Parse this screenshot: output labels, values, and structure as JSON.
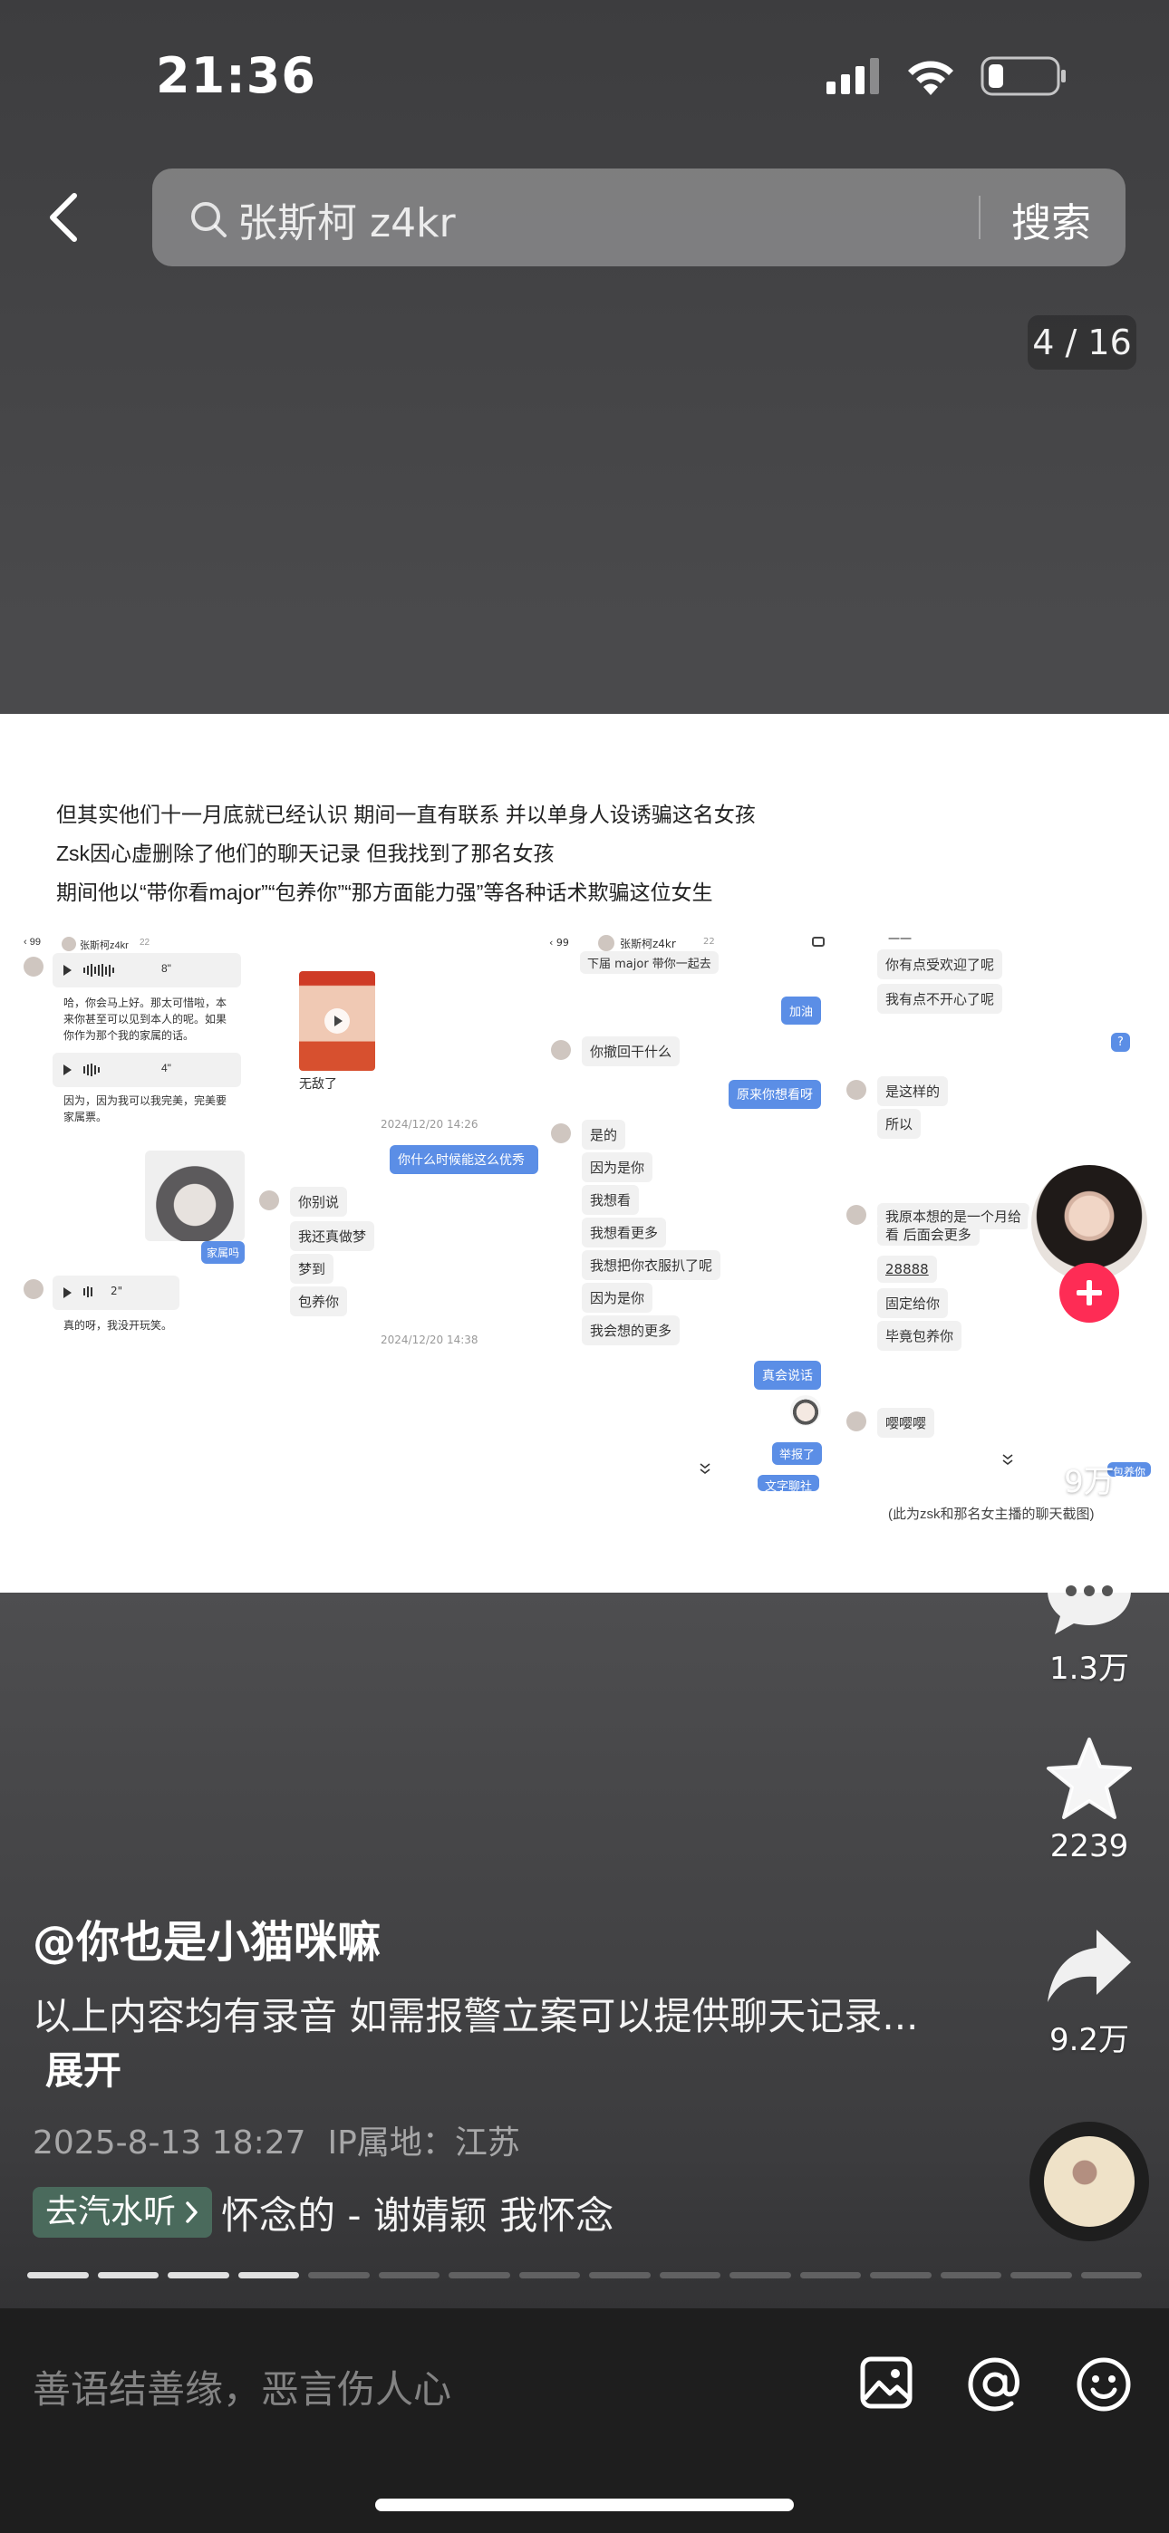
{
  "status_bar": {
    "time": "21:36"
  },
  "search": {
    "query": "张斯柯 z4kr",
    "button_label": "搜索"
  },
  "page_counter": "4 / 16",
  "post_image": {
    "caption_lines": [
      "但其实他们十一月底就已经认识 期间一直有联系 并以单身人设诱骗这名女孩",
      "Zsk因心虚删除了他们的聊天记录 但我找到了那名女孩",
      "期间他以“带你看major”“包养你”“那方面能力强”等各种话术欺骗这位女生"
    ],
    "left_chat": {
      "header_count": "99",
      "header_name": "张斯柯z4kr",
      "header_badge": "22",
      "voice1_duration": "8\"",
      "voice1_text": [
        "哈，你会马上好。那太可惜啦，本",
        "来你甚至可以见到本人的呢。如果",
        "你作为那个我的家属的话。"
      ],
      "voice2_duration": "4\"",
      "voice2_text": [
        "因为，因为我可以我完美，完美要",
        "家属票。"
      ],
      "blue_msg": "家属吗",
      "voice3_duration": "2\"",
      "voice3_text": [
        "真的呀，我没开玩笑。"
      ],
      "gift_label": "无敌了",
      "time1": "2024/12/20 14:26",
      "blue_msg2": "你什么时候能这么优秀",
      "msgs": [
        "你别说",
        "我还真做梦",
        "梦到",
        "包养你"
      ],
      "time2": "2024/12/20 14:38"
    },
    "right_chat": {
      "header_count": "99",
      "header_name": "张斯柯z4kr",
      "header_badge": "22",
      "top_msg": "下届 major 带你一起去",
      "blue1": "加油",
      "msg1": "你撤回干什么",
      "blue2": "原来你想看呀",
      "msgs": [
        "是的",
        "因为是你",
        "我想看",
        "我想看更多",
        "我想把你衣服扒了呢",
        "因为是你",
        "我会想的更多"
      ],
      "blue3": "真会说话",
      "blue4": "举报了",
      "blue5": "文字聊社"
    },
    "third_chat": {
      "top_msg": "一一",
      "msgs1": [
        "你有点受欢迎了呢",
        "我有点不开心了呢"
      ],
      "blue_q": "?",
      "msgs2": [
        "是这样的",
        "所以"
      ],
      "msgs3": [
        "我原本想的是一个月给",
        "看 后面会更多",
        "28888",
        "固定给你",
        "毕竟包养你"
      ],
      "msg4": "嘤嘤嘤",
      "blue_tail": "包养你"
    },
    "footnote": "(此为zsk和那名女主播的聊天截图)"
  },
  "actions": {
    "like_count": "9万",
    "comment_count": "1.3万",
    "favorite_count": "2239",
    "share_count": "9.2万"
  },
  "post": {
    "author": "@你也是小猫咪嘛",
    "description": "以上内容均有录音 如需报警立案可以提供聊天记录...",
    "expand_label": "展开",
    "date": "2025-8-13 18:27",
    "ip": "IP属地：江苏"
  },
  "music": {
    "badge_label": "去汽水听",
    "title": "怀念的 - 谢婧颖    我怀念"
  },
  "progress": {
    "total": 16,
    "current": 4
  },
  "comment_bar": {
    "placeholder": "善语结善缘，恶言伤人心"
  },
  "colors": {
    "accent": "#fe2c55",
    "chat_blue": "#5b8ee6",
    "badge_green": "#4a6a5c"
  }
}
